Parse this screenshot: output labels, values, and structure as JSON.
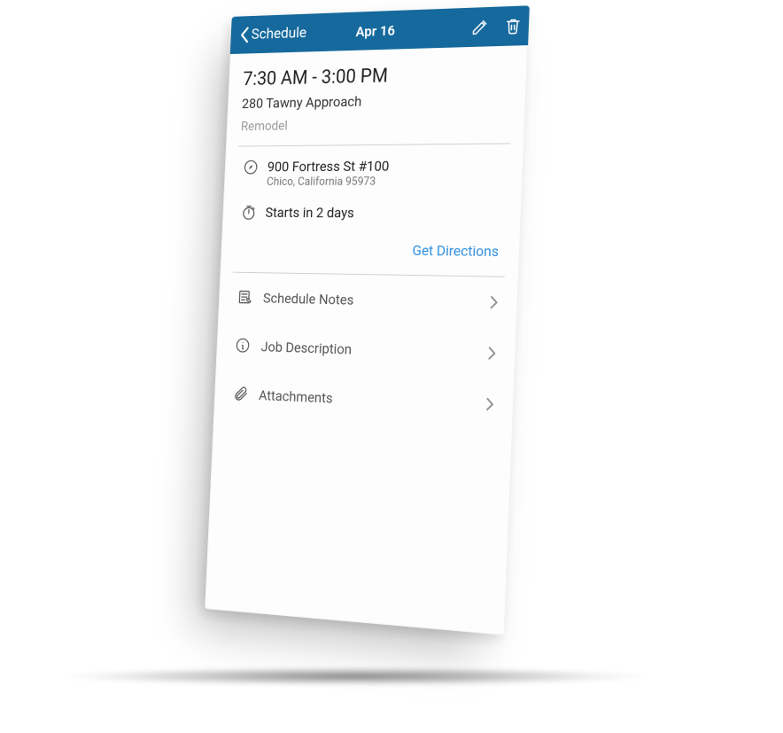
{
  "navbar": {
    "back_label": "Schedule",
    "title": "Apr 16"
  },
  "job": {
    "time_range": "7:30 AM - 3:00 PM",
    "name": "280 Tawny Approach",
    "type": "Remodel"
  },
  "location": {
    "line1": "900 Fortress St #100",
    "line2": "Chico, California 95973"
  },
  "starts": {
    "label": "Starts in 2 days"
  },
  "directions": {
    "label": "Get Directions"
  },
  "list": {
    "notes": "Schedule Notes",
    "description": "Job Description",
    "attachments": "Attachments"
  }
}
